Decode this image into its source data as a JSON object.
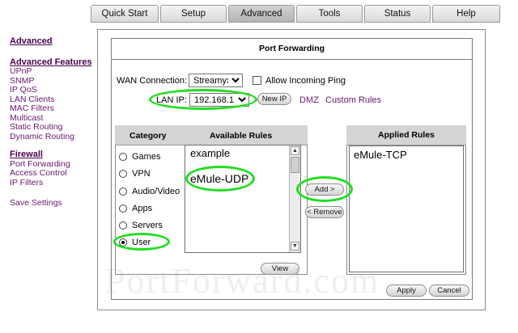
{
  "topnav": {
    "tabs": [
      {
        "label": "Quick Start"
      },
      {
        "label": "Setup"
      },
      {
        "label": "Advanced"
      },
      {
        "label": "Tools"
      },
      {
        "label": "Status"
      },
      {
        "label": "Help"
      }
    ],
    "active": "Advanced"
  },
  "sidebar": {
    "title": "Advanced",
    "features_heading": "Advanced Features",
    "features": [
      "UPnP",
      "SNMP",
      "IP QoS",
      "LAN Clients",
      "MAC Filters",
      "Multicast",
      "Static Routing",
      "Dynamic Routing"
    ],
    "firewall_heading": "Firewall",
    "firewall": [
      "Port Forwarding",
      "Access Control",
      "IP Filters"
    ],
    "save": "Save Settings"
  },
  "panel": {
    "title": "Port Forwarding",
    "wan_label": "WAN Connection:",
    "wan_value": "Streamyx",
    "allow_ping_label": "Allow Incoming Ping",
    "allow_ping_checked": false,
    "lan_label": "LAN IP:",
    "lan_value": "192.168.1.2",
    "new_ip_button": "New IP",
    "dmz_link": "DMZ",
    "custom_rules_link": "Custom Rules"
  },
  "category": {
    "heading": "Category",
    "available_heading": "Available Rules",
    "options": [
      "Games",
      "VPN",
      "Audio/Video",
      "Apps",
      "Servers",
      "User"
    ],
    "selected": "User",
    "rules": [
      "example",
      "eMule-UDP"
    ],
    "view_button": "View"
  },
  "actions": {
    "add_button": "Add >",
    "remove_button": "< Remove"
  },
  "applied": {
    "heading": "Applied Rules",
    "rules": [
      "eMule-TCP"
    ]
  },
  "footer": {
    "apply_button": "Apply",
    "cancel_button": "Cancel"
  },
  "watermark": "PortForward.com",
  "colors": {
    "highlight": "#22dd22",
    "link": "#6a1670",
    "header_bg": "#d4d4d4"
  }
}
